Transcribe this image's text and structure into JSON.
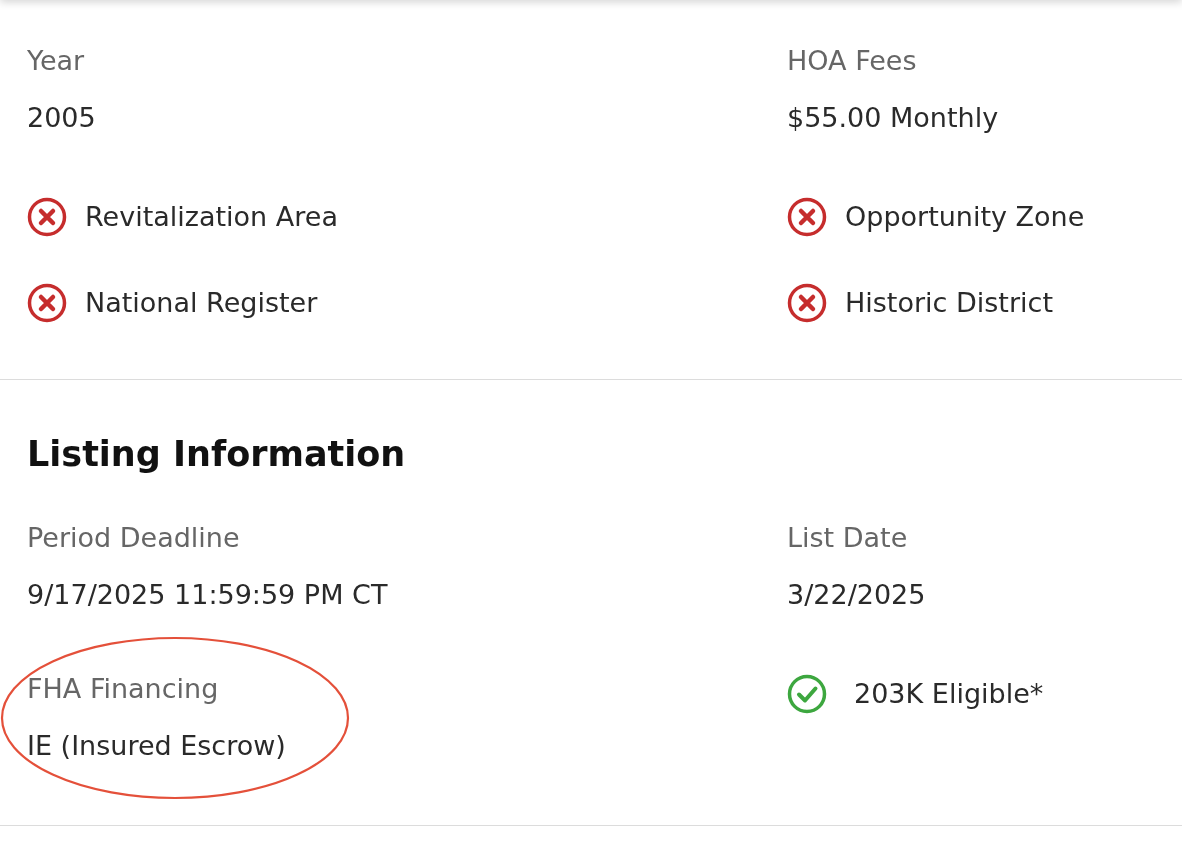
{
  "sections": [
    {
      "items": [
        {
          "kind": "field",
          "label": "Year",
          "value": "2005"
        },
        {
          "kind": "field",
          "label": "HOA Fees",
          "value": "$55.00 Monthly"
        },
        {
          "kind": "flag",
          "label": "Revitalization Area",
          "checked": false
        },
        {
          "kind": "flag",
          "label": "Opportunity Zone",
          "checked": false
        },
        {
          "kind": "flag",
          "label": "National Register",
          "checked": false
        },
        {
          "kind": "flag",
          "label": "Historic District",
          "checked": false
        }
      ]
    },
    {
      "heading": "Listing Information",
      "items": [
        {
          "kind": "field",
          "label": "Period Deadline",
          "value": "9/17/2025 11:59:59 PM CT"
        },
        {
          "kind": "field",
          "label": "List Date",
          "value": "3/22/2025"
        },
        {
          "kind": "field",
          "label": "FHA Financing",
          "value": "IE (Insured Escrow)",
          "circled": true
        },
        {
          "kind": "flag",
          "label": "203K Eligible*",
          "checked": true
        }
      ]
    }
  ]
}
